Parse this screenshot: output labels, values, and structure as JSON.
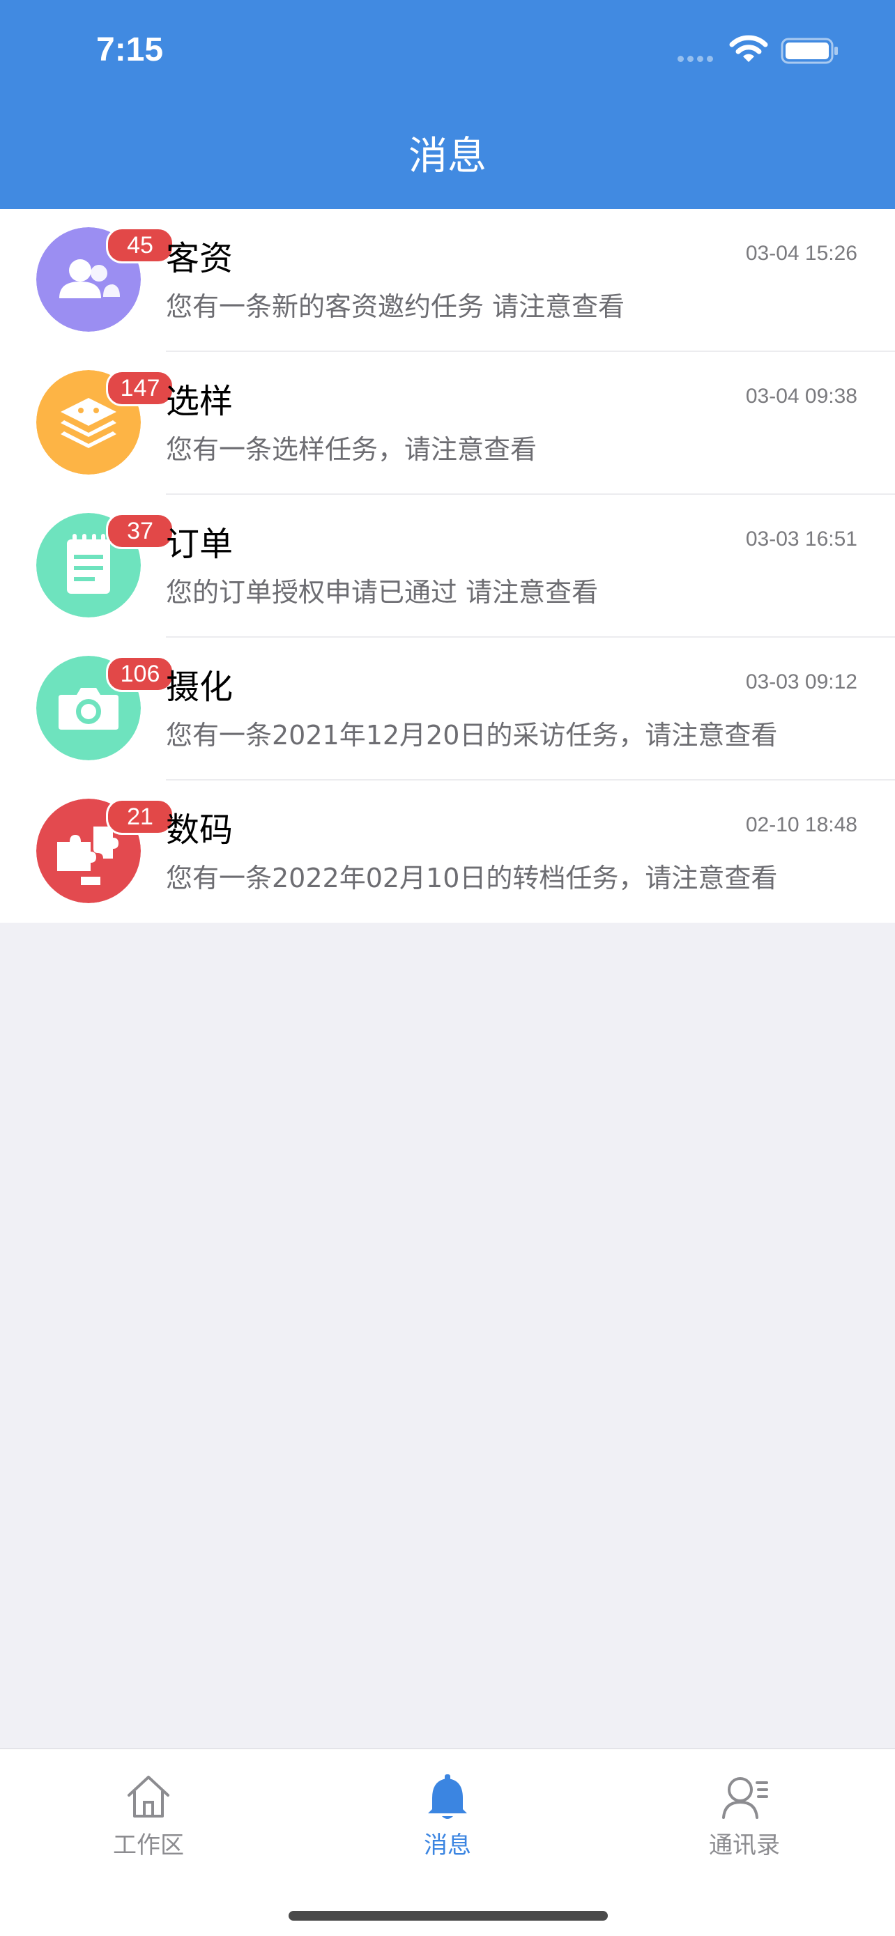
{
  "status_bar": {
    "time": "7:15"
  },
  "header": {
    "title": "消息"
  },
  "messages": [
    {
      "title": "客资",
      "badge": "45",
      "time": "03-04 15:26",
      "subtitle": "您有一条新的客资邀约任务 请注意查看",
      "icon": "customers-icon",
      "color": "#9b8ef2"
    },
    {
      "title": "选样",
      "badge": "147",
      "time": "03-04 09:38",
      "subtitle": "您有一条选样任务，请注意查看",
      "icon": "layers-icon",
      "color": "#fdb445"
    },
    {
      "title": "订单",
      "badge": "37",
      "time": "03-03 16:51",
      "subtitle": "您的订单授权申请已通过 请注意查看",
      "icon": "notepad-icon",
      "color": "#6ee3be"
    },
    {
      "title": "摄化",
      "badge": "106",
      "time": "03-03 09:12",
      "subtitle": "您有一条2021年12月20日的采访任务，请注意查看",
      "icon": "camera-icon",
      "color": "#6ee3be"
    },
    {
      "title": "数码",
      "badge": "21",
      "time": "02-10 18:48",
      "subtitle": "您有一条2022年02月10日的转档任务，请注意查看",
      "icon": "puzzle-icon",
      "color": "#e34a4f"
    }
  ],
  "tabbar": {
    "items": [
      {
        "label": "工作区",
        "icon": "home-icon"
      },
      {
        "label": "消息",
        "icon": "bell-icon",
        "active": true
      },
      {
        "label": "通讯录",
        "icon": "contacts-icon"
      }
    ]
  },
  "colors": {
    "header": "#418ae1",
    "badge": "#e24848",
    "active_tab": "#3b85e1"
  }
}
